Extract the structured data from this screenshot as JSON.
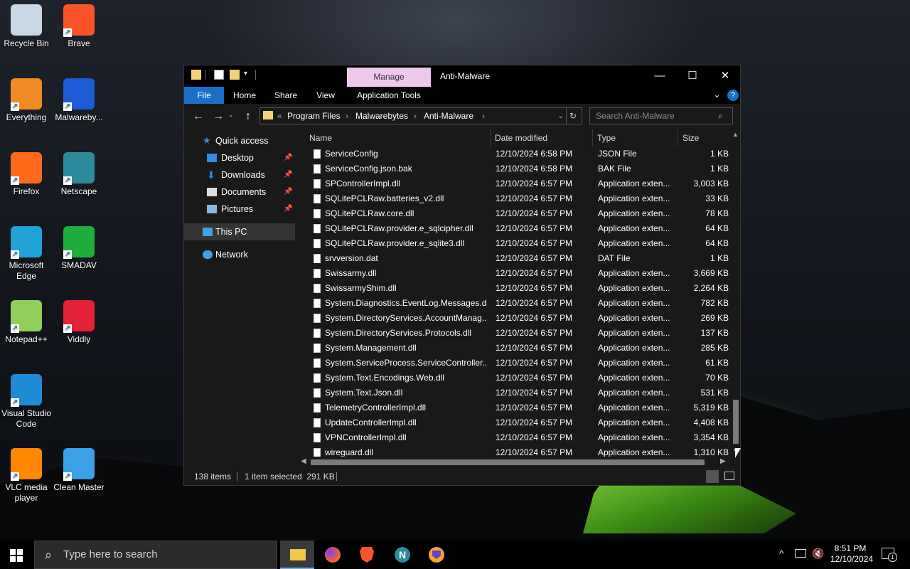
{
  "desktop_icons": [
    {
      "label": "Recycle Bin",
      "icon": "recycle-bin-icon"
    },
    {
      "label": "Brave",
      "icon": "brave-icon"
    },
    {
      "label": "Everything",
      "icon": "everything-search-icon"
    },
    {
      "label": "Malwareby...",
      "icon": "malwarebytes-icon"
    },
    {
      "label": "Firefox",
      "icon": "firefox-icon"
    },
    {
      "label": "Netscape",
      "icon": "netscape-icon"
    },
    {
      "label": "Microsoft Edge",
      "icon": "edge-icon"
    },
    {
      "label": "SMADAV",
      "icon": "smadav-icon"
    },
    {
      "label": "Notepad++",
      "icon": "notepad-plus-plus-icon"
    },
    {
      "label": "Viddly",
      "icon": "viddly-icon"
    },
    {
      "label": "Visual Studio Code",
      "icon": "vscode-icon"
    },
    {
      "label": "VLC media player",
      "icon": "vlc-icon"
    },
    {
      "label": "Clean Master",
      "icon": "clean-master-icon"
    }
  ],
  "window": {
    "title": "Anti-Malware",
    "context_tab": "Manage",
    "ribbon_tabs": [
      "File",
      "Home",
      "Share",
      "View",
      "Application Tools"
    ],
    "breadcrumb": [
      "Program Files",
      "Malwarebytes",
      "Anti-Malware"
    ],
    "breadcrumb_prefix": "«",
    "search_placeholder": "Search Anti-Malware",
    "nav": [
      {
        "label": "Quick access",
        "icon": "star-icon"
      },
      {
        "label": "Desktop",
        "icon": "desktop-folder-icon",
        "pinned": true
      },
      {
        "label": "Downloads",
        "icon": "downloads-folder-icon",
        "pinned": true
      },
      {
        "label": "Documents",
        "icon": "documents-folder-icon",
        "pinned": true
      },
      {
        "label": "Pictures",
        "icon": "pictures-folder-icon",
        "pinned": true
      },
      {
        "label": "This PC",
        "icon": "this-pc-icon",
        "selected": true
      },
      {
        "label": "Network",
        "icon": "network-icon"
      }
    ],
    "columns": [
      "Name",
      "Date modified",
      "Type",
      "Size"
    ],
    "files": [
      {
        "name": "ServiceConfig",
        "date": "12/10/2024 6:58 PM",
        "type": "JSON File",
        "size": "1 KB"
      },
      {
        "name": "ServiceConfig.json.bak",
        "date": "12/10/2024 6:58 PM",
        "type": "BAK File",
        "size": "1 KB"
      },
      {
        "name": "SPControllerImpl.dll",
        "date": "12/10/2024 6:57 PM",
        "type": "Application exten...",
        "size": "3,003 KB"
      },
      {
        "name": "SQLitePCLRaw.batteries_v2.dll",
        "date": "12/10/2024 6:57 PM",
        "type": "Application exten...",
        "size": "33 KB"
      },
      {
        "name": "SQLitePCLRaw.core.dll",
        "date": "12/10/2024 6:57 PM",
        "type": "Application exten...",
        "size": "78 KB"
      },
      {
        "name": "SQLitePCLRaw.provider.e_sqlcipher.dll",
        "date": "12/10/2024 6:57 PM",
        "type": "Application exten...",
        "size": "64 KB"
      },
      {
        "name": "SQLitePCLRaw.provider.e_sqlite3.dll",
        "date": "12/10/2024 6:57 PM",
        "type": "Application exten...",
        "size": "64 KB"
      },
      {
        "name": "srvversion.dat",
        "date": "12/10/2024 6:57 PM",
        "type": "DAT File",
        "size": "1 KB"
      },
      {
        "name": "Swissarmy.dll",
        "date": "12/10/2024 6:57 PM",
        "type": "Application exten...",
        "size": "3,669 KB"
      },
      {
        "name": "SwissarmyShim.dll",
        "date": "12/10/2024 6:57 PM",
        "type": "Application exten...",
        "size": "2,264 KB"
      },
      {
        "name": "System.Diagnostics.EventLog.Messages.dll",
        "date": "12/10/2024 6:57 PM",
        "type": "Application exten...",
        "size": "782 KB"
      },
      {
        "name": "System.DirectoryServices.AccountManag...",
        "date": "12/10/2024 6:57 PM",
        "type": "Application exten...",
        "size": "269 KB"
      },
      {
        "name": "System.DirectoryServices.Protocols.dll",
        "date": "12/10/2024 6:57 PM",
        "type": "Application exten...",
        "size": "137 KB"
      },
      {
        "name": "System.Management.dll",
        "date": "12/10/2024 6:57 PM",
        "type": "Application exten...",
        "size": "285 KB"
      },
      {
        "name": "System.ServiceProcess.ServiceController....",
        "date": "12/10/2024 6:57 PM",
        "type": "Application exten...",
        "size": "61 KB"
      },
      {
        "name": "System.Text.Encodings.Web.dll",
        "date": "12/10/2024 6:57 PM",
        "type": "Application exten...",
        "size": "70 KB"
      },
      {
        "name": "System.Text.Json.dll",
        "date": "12/10/2024 6:57 PM",
        "type": "Application exten...",
        "size": "531 KB"
      },
      {
        "name": "TelemetryControllerImpl.dll",
        "date": "12/10/2024 6:57 PM",
        "type": "Application exten...",
        "size": "5,319 KB"
      },
      {
        "name": "UpdateControllerImpl.dll",
        "date": "12/10/2024 6:57 PM",
        "type": "Application exten...",
        "size": "4,408 KB"
      },
      {
        "name": "VPNControllerImpl.dll",
        "date": "12/10/2024 6:57 PM",
        "type": "Application exten...",
        "size": "3,354 KB"
      },
      {
        "name": "wireguard.dll",
        "date": "12/10/2024 6:57 PM",
        "type": "Application exten...",
        "size": "1,310 KB"
      }
    ],
    "status": {
      "items": "138 items",
      "selected": "1 item selected  291 KB"
    }
  },
  "taskbar": {
    "search_placeholder": "Type here to search",
    "apps": [
      "file-explorer-icon",
      "firefox-icon",
      "brave-icon",
      "netscape-icon",
      "vpn-shield-icon"
    ],
    "time": "8:51 PM",
    "date": "12/10/2024",
    "notification_count": "1"
  }
}
